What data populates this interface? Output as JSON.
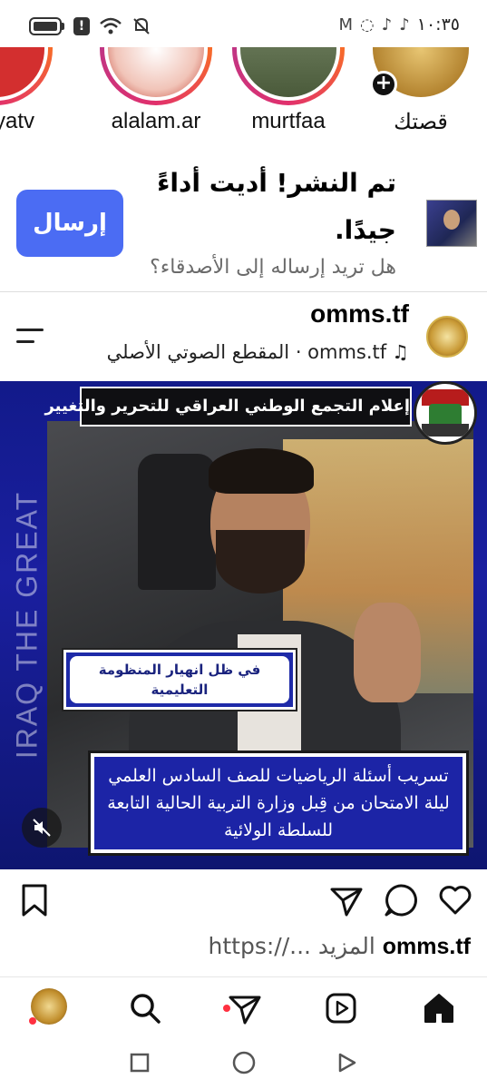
{
  "status_bar": {
    "time": "١٠:٣٥"
  },
  "stories": {
    "items": [
      {
        "name": "arqiyatv"
      },
      {
        "name": "alalam.ar"
      },
      {
        "name": "murtfaa"
      },
      {
        "name": "قصتك"
      }
    ]
  },
  "share_prompt": {
    "title": "تم النشر! أديت أداءً جيدًا.",
    "subtitle": "هل تريد إرساله إلى الأصدقاء؟",
    "send_label": "إرسال"
  },
  "post": {
    "username": "omms.tf",
    "audio_text": "المقطع الصوتي الأصلي · omms.tf",
    "video": {
      "top_banner": "إعلام التجمع الوطني العراقي للتحرير والتغيير",
      "side_text": "IRAQ THE GREAT",
      "label_box": "في ظل انهيار المنظومة التعليمية",
      "caption_overlay": "تسريب أسئلة الرياضيات للصف السادس العلمي ليلة الامتحان من قِبل وزارة التربية الحالية التابعة للسلطة الولائية"
    },
    "caption": {
      "username": "omms.tf",
      "text": "https://... المزيد"
    }
  },
  "colors": {
    "send_button": "#4b6cf3",
    "video_bg": "#1a1fa0",
    "notification_dot": "#ff3040"
  }
}
